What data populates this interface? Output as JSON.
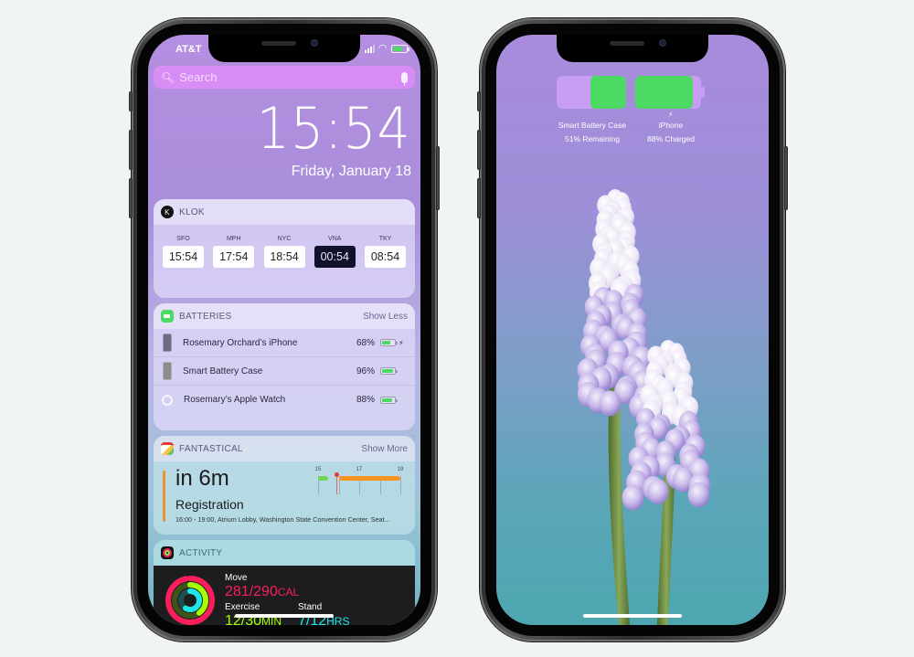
{
  "left_phone": {
    "status_bar": {
      "carrier": "AT&T",
      "battery_fill_percent": 68,
      "charging": true
    },
    "search": {
      "placeholder": "Search",
      "search_icon": "magnifier-icon",
      "mic_icon": "microphone-icon"
    },
    "lock_time": "15:54",
    "lock_date": "Friday, January 18",
    "widgets": {
      "klok": {
        "title": "KLOK",
        "clocks": [
          {
            "city": "SFO",
            "time": "15:54",
            "active": false
          },
          {
            "city": "MPH",
            "time": "17:54",
            "active": false
          },
          {
            "city": "NYC",
            "time": "18:54",
            "active": false
          },
          {
            "city": "VNA",
            "time": "00:54",
            "active": true
          },
          {
            "city": "TKY",
            "time": "08:54",
            "active": false
          }
        ]
      },
      "batteries": {
        "title": "BATTERIES",
        "action": "Show Less",
        "devices": [
          {
            "name": "Rosemary Orchard’s iPhone",
            "percent_label": "68%",
            "percent": 68,
            "charging": true,
            "icon": "iphone-icon"
          },
          {
            "name": "Smart Battery Case",
            "percent_label": "96%",
            "percent": 96,
            "charging": false,
            "icon": "battery-case-icon"
          },
          {
            "name": "Rosemary’s Apple Watch",
            "percent_label": "88%",
            "percent": 88,
            "charging": false,
            "icon": "apple-watch-icon"
          }
        ]
      },
      "fantastical": {
        "title": "FANTASTICAL",
        "action": "Show More",
        "countdown": "in 6m",
        "event_title": "Registration",
        "event_details": "16:00 - 19:00, Atrium Lobby, Washington State Convention Center, Seat...",
        "timeline": {
          "hour_labels": [
            "15",
            "17",
            "19"
          ],
          "hours": [
            15,
            17,
            19
          ],
          "range": [
            15,
            19
          ],
          "now_hour": 15.9,
          "events": [
            {
              "start": 15.0,
              "end": 15.5,
              "color": "#6fd65a"
            },
            {
              "start": 16.0,
              "end": 19.0,
              "color": "#f7931e"
            }
          ]
        }
      },
      "activity": {
        "title": "ACTIVITY",
        "move_label": "Move",
        "move_value": "281/290",
        "move_unit": "CAL",
        "exercise_label": "Exercise",
        "exercise_value": "12/30",
        "exercise_unit": "MIN",
        "stand_label": "Stand",
        "stand_value": "7/12",
        "stand_unit": "HRS",
        "rings": {
          "move": 0.97,
          "exercise": 0.4,
          "stand": 0.58
        },
        "colors": {
          "move": "#fa1e5a",
          "exercise": "#a6ff00",
          "stand": "#1ee6e6"
        }
      }
    }
  },
  "right_phone": {
    "battery_widget": {
      "case_label": "Smart Battery Case",
      "case_status": "51% Remaining",
      "case_percent": 51,
      "iphone_label": "iPhone",
      "iphone_status": "88% Charged",
      "iphone_percent": 88,
      "iphone_charging": true
    },
    "wallpaper": "grape-hyacinth-flowers"
  },
  "colors": {
    "battery_green": "#4cd964",
    "case_purple": "#c79ef3",
    "page_background": "#f1f4f5",
    "search_pink": "#d88cf5"
  }
}
